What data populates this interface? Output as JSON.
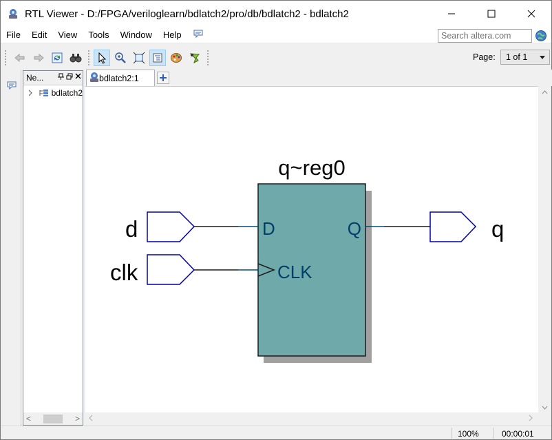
{
  "window": {
    "title": "RTL Viewer - D:/FPGA/veriloglearn/bdlatch2/pro/db/bdlatch2 - bdlatch2",
    "controls": {
      "minimize": "─",
      "maximize": "☐",
      "close": "✕"
    }
  },
  "menu": {
    "items": [
      "File",
      "Edit",
      "View",
      "Tools",
      "Window",
      "Help"
    ]
  },
  "search": {
    "placeholder": "Search altera.com"
  },
  "toolbar": {
    "buttons": [
      "back-icon",
      "forward-icon",
      "refresh-icon",
      "find-icon",
      "select-icon",
      "zoom-icon",
      "fit-icon",
      "netlist-icon",
      "palette-icon",
      "filter-icon"
    ],
    "page_label": "Page:",
    "page_value": "1 of 1"
  },
  "nav_panel": {
    "title": "Ne...",
    "tree_item": "bdlatch2"
  },
  "tabs": {
    "doc_tab": "bdlatch2:1"
  },
  "schematic": {
    "register_name": "q~reg0",
    "inputs": [
      "d",
      "clk"
    ],
    "output": "q",
    "ports": {
      "d": "D",
      "clk": "CLK",
      "q": "Q"
    },
    "colors": {
      "register_fill": "#70a9a9",
      "shadow": "#a0a0a0",
      "pin_stroke": "#0000a8",
      "port_text": "#003f6a"
    }
  },
  "status": {
    "zoom": "100%",
    "time": "00:00:01"
  }
}
